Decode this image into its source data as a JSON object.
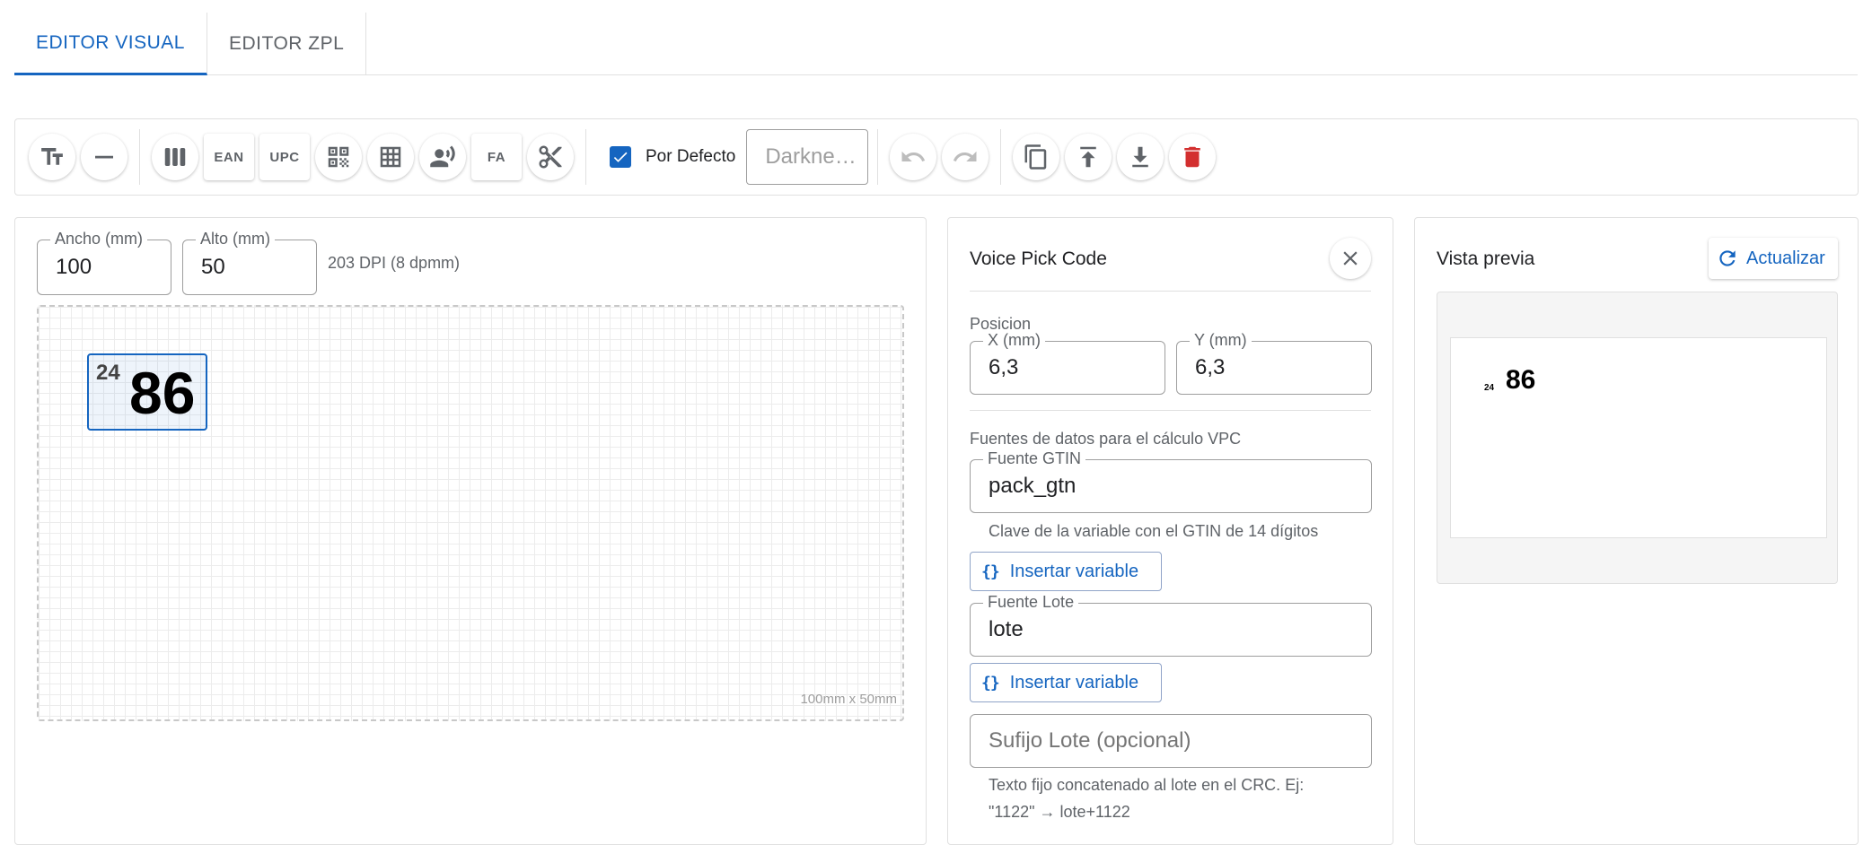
{
  "tabs": [
    {
      "label": "EDITOR VISUAL",
      "active": true
    },
    {
      "label": "EDITOR ZPL",
      "active": false
    }
  ],
  "toolbar": {
    "ean_label": "EAN",
    "upc_label": "UPC",
    "fa_label": "FA",
    "default_checkbox_label": "Por Defecto",
    "darkness_placeholder": "Darkne…",
    "icons": [
      "text-icon",
      "line-icon",
      "barcode-icon",
      "qr-icon",
      "table-icon",
      "voice-icon",
      "scissors-icon",
      "undo-icon",
      "redo-icon",
      "copy-icon",
      "upload-icon",
      "download-icon",
      "delete-icon"
    ]
  },
  "label_settings": {
    "width_label": "Ancho (mm)",
    "width_value": "100",
    "height_label": "Alto (mm)",
    "height_value": "50",
    "dpi_text": "203 DPI (8 dpmm)",
    "canvas_size_text": "100mm x 50mm"
  },
  "canvas_element": {
    "small_text": "24",
    "big_text": "86"
  },
  "properties": {
    "title": "Voice Pick Code",
    "position_label": "Posicion",
    "x_label": "X (mm)",
    "x_value": "6,3",
    "y_label": "Y (mm)",
    "y_value": "6,3",
    "sources_label": "Fuentes de datos para el cálculo VPC",
    "gtin_label": "Fuente GTIN",
    "gtin_value": "pack_gtn",
    "gtin_helper": "Clave de la variable con el GTIN de 14 dígitos",
    "insert_variable_label": "Insertar variable",
    "lot_label": "Fuente Lote",
    "lot_value": "lote",
    "suffix_placeholder": "Sufijo Lote (opcional)",
    "suffix_helper_1": "Texto fijo concatenado al lote en el CRC. Ej:",
    "suffix_helper_2": "\"1122\" → lote+1122"
  },
  "preview": {
    "title": "Vista previa",
    "refresh_label": "Actualizar",
    "small_text": "24",
    "big_text": "86"
  },
  "colors": {
    "accent": "#1565c0",
    "danger": "#d32f2f"
  }
}
